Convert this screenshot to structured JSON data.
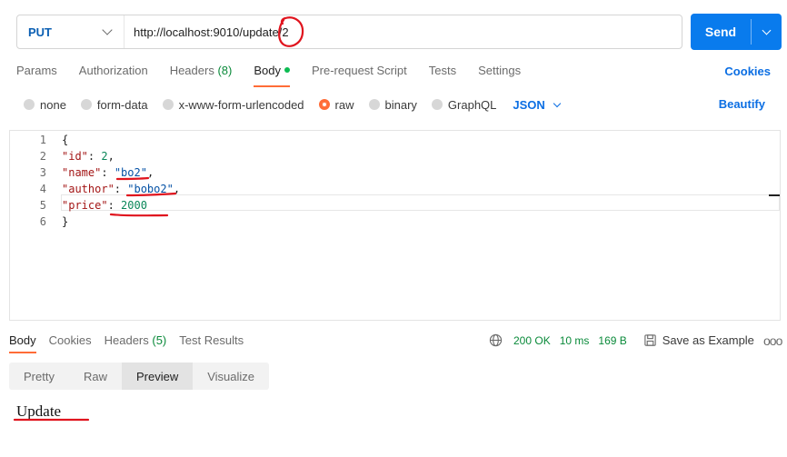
{
  "request": {
    "method": "PUT",
    "url": "http://localhost:9010/update/2",
    "send_label": "Send"
  },
  "tabs": {
    "params": "Params",
    "authorization": "Authorization",
    "headers": "Headers",
    "headers_count": "(8)",
    "body": "Body",
    "pre_request": "Pre-request Script",
    "tests": "Tests",
    "settings": "Settings",
    "cookies": "Cookies"
  },
  "body_types": {
    "none": "none",
    "form_data": "form-data",
    "urlencoded": "x-www-form-urlencoded",
    "raw": "raw",
    "binary": "binary",
    "graphql": "GraphQL",
    "format": "JSON",
    "beautify": "Beautify",
    "selected": "raw"
  },
  "editor": {
    "lines": [
      {
        "n": "1",
        "text": "{"
      },
      {
        "n": "2",
        "key": "\"id\"",
        "val": "2",
        "vtype": "num",
        "end": ","
      },
      {
        "n": "3",
        "key": "\"name\"",
        "val": "\"bo2\"",
        "vtype": "str",
        "end": ","
      },
      {
        "n": "4",
        "key": "\"author\"",
        "val": "\"bobo2\"",
        "vtype": "str",
        "end": ","
      },
      {
        "n": "5",
        "key": "\"price\"",
        "val": "2000",
        "vtype": "num",
        "end": ""
      },
      {
        "n": "6",
        "text": "}"
      }
    ]
  },
  "response": {
    "tabs": {
      "body": "Body",
      "cookies": "Cookies",
      "headers": "Headers",
      "headers_count": "(5)",
      "test_results": "Test Results"
    },
    "status": "200 OK",
    "time": "10 ms",
    "size": "169 B",
    "save_example": "Save as Example",
    "more": "ooo",
    "views": {
      "pretty": "Pretty",
      "raw": "Raw",
      "preview": "Preview",
      "visualize": "Visualize"
    },
    "preview_text": "Update"
  },
  "colors": {
    "accent": "#ff6c37",
    "primary": "#097bed",
    "link": "#0b6ee3",
    "success": "#0a8a3a",
    "annotation": "#e0141e"
  }
}
